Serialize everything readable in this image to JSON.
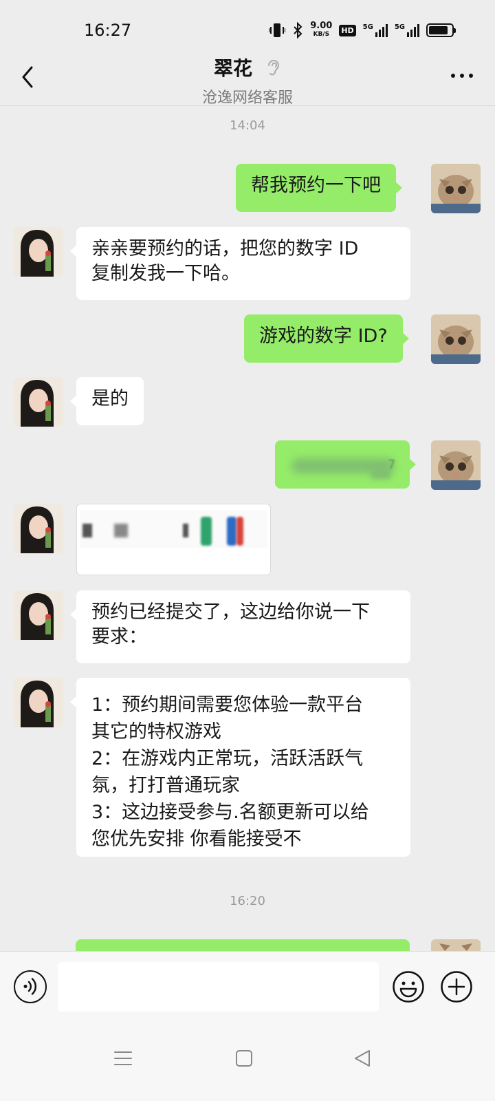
{
  "status_bar": {
    "time": "16:27",
    "speed_value": "9.00",
    "speed_unit": "KB/S",
    "hd_label": "HD",
    "net1": "5G",
    "net2": "5G"
  },
  "header": {
    "title": "翠花",
    "subtitle": "沧逸网络客服"
  },
  "timestamps": [
    "14:04",
    "16:20"
  ],
  "messages": [
    {
      "side": "out",
      "text": "帮我预约一下吧"
    },
    {
      "side": "in",
      "text_lines": [
        "亲亲要预约的话，把您的数字 ID",
        "复制发我一下哈。"
      ]
    },
    {
      "side": "out",
      "text": "游戏的数字 ID?"
    },
    {
      "side": "in",
      "text": "是的"
    },
    {
      "side": "out",
      "type": "redacted",
      "visible_char": "7"
    },
    {
      "side": "in",
      "type": "image"
    },
    {
      "side": "in",
      "text_lines": [
        "预约已经提交了，这边给你说一下",
        "要求："
      ]
    },
    {
      "side": "in",
      "text_lines": [
        "1：预约期间需要您体验一款平台",
        "其它的特权游戏",
        "2：在游戏内正常玩，活跃活跃气",
        "氛，打打普通玩家",
        "3：这边接受参与.名额更新可以给",
        "您优先安排 你看能接受不"
      ]
    },
    {
      "side": "out",
      "type": "partial"
    }
  ],
  "input": {
    "placeholder": ""
  },
  "icons": {
    "back": "chevron-left-icon",
    "more": "more-dots-icon",
    "ear": "ear-icon",
    "voice": "voice-icon",
    "emoji": "emoji-icon",
    "plus": "plus-icon"
  },
  "colors": {
    "bubble_out": "#95ec69",
    "bubble_in": "#ffffff",
    "background": "#ededed"
  }
}
